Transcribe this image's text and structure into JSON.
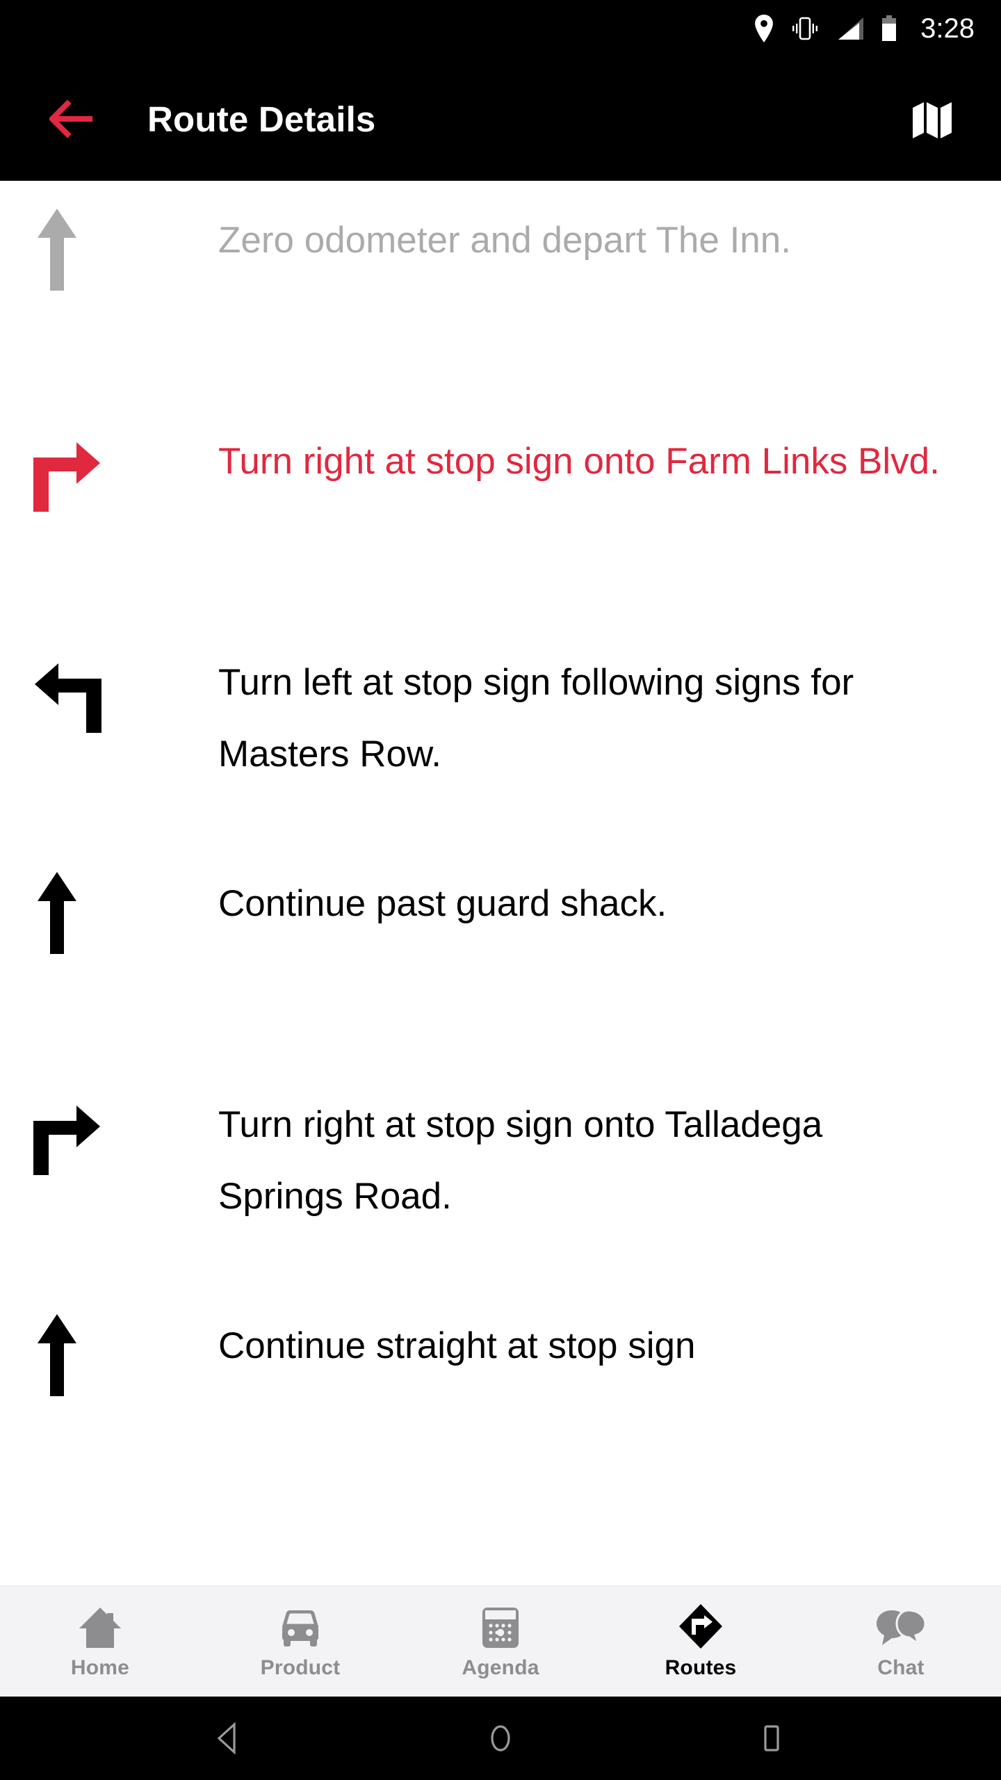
{
  "status_bar": {
    "time": "3:28",
    "icons": [
      "location-pin-icon",
      "vibrate-icon",
      "signal-bars-icon",
      "battery-icon"
    ]
  },
  "app_bar": {
    "title": "Route Details",
    "back_icon": "back-arrow-icon",
    "map_icon": "map-icon",
    "background_color": "#000000",
    "back_arrow_color": "#e0283f",
    "title_color": "#ffffff"
  },
  "colors": {
    "accent_red": "#e0283f",
    "muted_gray": "#ababab",
    "body_black": "#000000",
    "nav_background": "#f3f2f4",
    "nav_inactive": "#8d8d8f"
  },
  "route_steps": [
    {
      "text": "Zero odometer and depart The Inn.",
      "icon": "arrow-straight-icon",
      "state": "completed"
    },
    {
      "text": "Turn right at stop sign onto Farm Links Blvd.",
      "icon": "arrow-turn-right-icon",
      "state": "current"
    },
    {
      "text": "Turn left at stop sign following signs for Masters Row.",
      "icon": "arrow-turn-left-icon",
      "state": "upcoming"
    },
    {
      "text": "Continue past guard shack.",
      "icon": "arrow-straight-icon",
      "state": "upcoming"
    },
    {
      "text": "Turn right at stop sign onto Talladega Springs Road.",
      "icon": "arrow-turn-right-icon",
      "state": "upcoming"
    },
    {
      "text": "Continue straight at stop sign",
      "icon": "arrow-straight-icon",
      "state": "upcoming"
    }
  ],
  "bottom_nav": {
    "items": [
      {
        "label": "Home",
        "icon": "home-icon",
        "active": false
      },
      {
        "label": "Product",
        "icon": "car-icon",
        "active": false
      },
      {
        "label": "Agenda",
        "icon": "calendar-icon",
        "active": false
      },
      {
        "label": "Routes",
        "icon": "routes-diamond-icon",
        "active": true
      },
      {
        "label": "Chat",
        "icon": "chat-bubbles-icon",
        "active": false
      }
    ]
  },
  "system_nav": {
    "back": "system-back-icon",
    "home": "system-home-icon",
    "recents": "system-recents-icon"
  }
}
